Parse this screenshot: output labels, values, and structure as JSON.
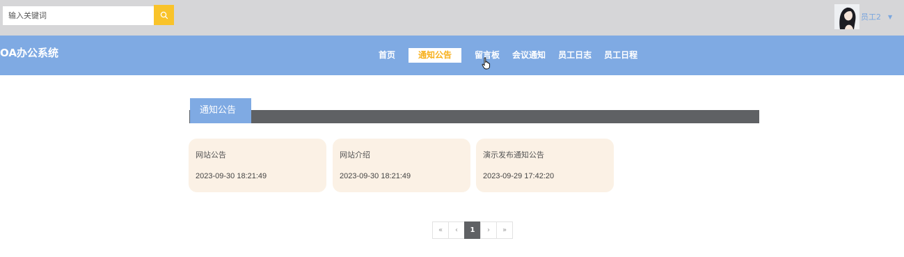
{
  "search": {
    "placeholder": "输入关键词"
  },
  "user": {
    "name": "员工2"
  },
  "logo": "OA办公系统",
  "nav": [
    "首页",
    "通知公告",
    "留言板",
    "会议通知",
    "员工日志",
    "员工日程"
  ],
  "nav_active": "通知公告",
  "section": {
    "title": "通知公告"
  },
  "cards": [
    {
      "title": "网站公告",
      "date": "2023-09-30 18:21:49"
    },
    {
      "title": "网站介绍",
      "date": "2023-09-30 18:21:49"
    },
    {
      "title": "演示发布通知公告",
      "date": "2023-09-29 17:42:20"
    }
  ],
  "pagination": {
    "first": "«",
    "prev": "‹",
    "current": "1",
    "next": "›",
    "last": "»"
  },
  "colors": {
    "accent": "#7faae3",
    "nav_active_text": "#f7b01c",
    "search_button": "#f9c32a",
    "card_bg": "#fbf1e5",
    "bar": "#5f6164"
  }
}
